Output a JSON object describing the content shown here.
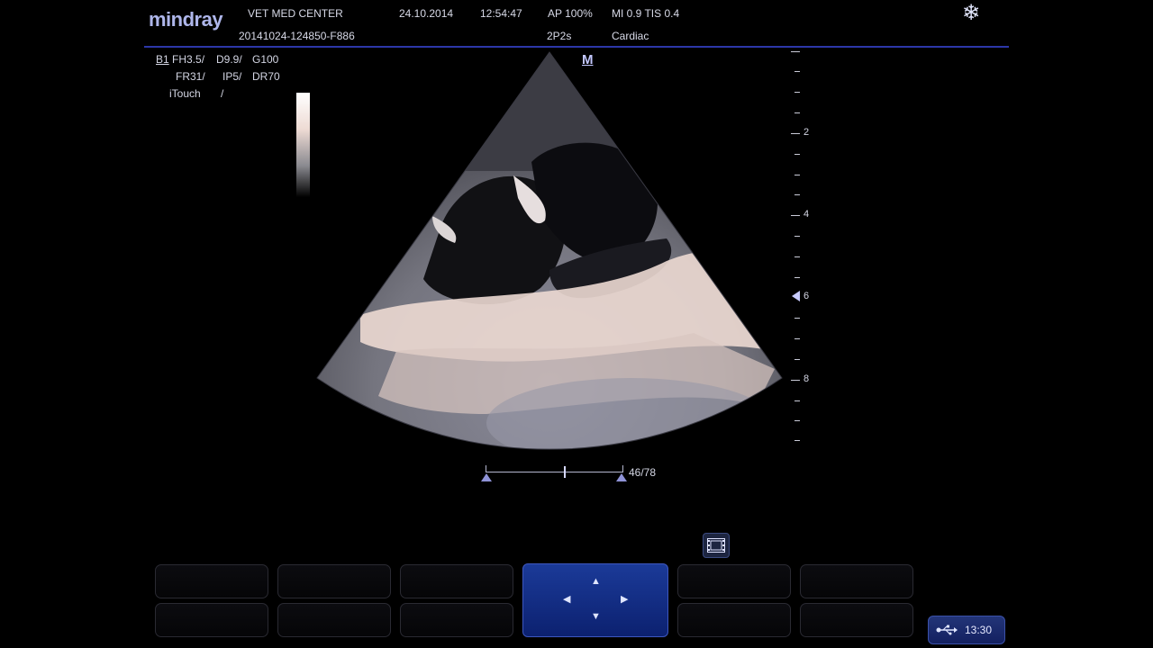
{
  "header": {
    "logo": "mindray",
    "institution": "VET MED CENTER",
    "exam_id": "20141024-124850-F886",
    "date": "24.10.2014",
    "time": "12:54:47",
    "ap": "AP  100%",
    "preset": "2P2s",
    "mi_tis": "MI 0.9  TIS 0.4",
    "exam_type": "Cardiac",
    "freeze_icon": "snowflake-icon"
  },
  "params": {
    "mode": "B1",
    "fh": "FH3.5/",
    "d": "D9.9/",
    "g": "G100",
    "fr": "FR31/",
    "ip": "IP5/",
    "dr": "DR70",
    "itouch": "iTouch",
    "itouch_val": "/"
  },
  "orientation_marker": "M",
  "depth_labels": [
    "2",
    "4",
    "6",
    "8"
  ],
  "cine": {
    "frame": "46/78"
  },
  "status": {
    "clock": "13:30",
    "usb_icon": "usb-icon"
  },
  "icons": {
    "film": "film-strip-icon",
    "joystick": "joystick-arrows-icon"
  }
}
